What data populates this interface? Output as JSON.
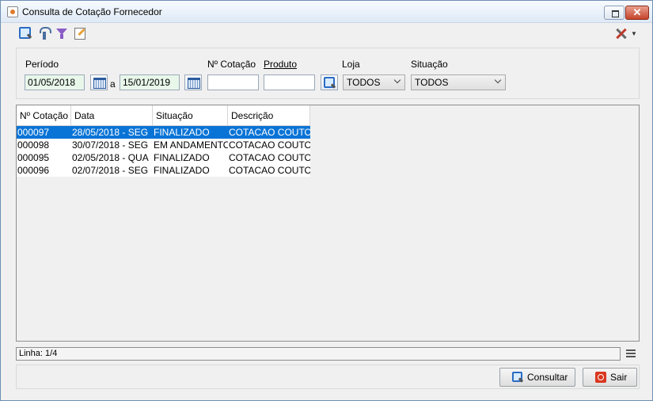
{
  "window": {
    "title": "Consulta de Cotação Fornecedor",
    "close_glyph": "✕"
  },
  "toolbar": {
    "icons": [
      "search-icon",
      "gauge-icon",
      "filter-icon",
      "edit-icon",
      "tools-icon"
    ]
  },
  "filters": {
    "periodo_label": "Período",
    "date_from": "01/05/2018",
    "a_label": "a",
    "date_to": "15/01/2019",
    "cotacao_label": "Nº Cotação",
    "cotacao_value": "",
    "produto_label": "Produto",
    "produto_value": "",
    "loja_label": "Loja",
    "loja_value": "TODOS",
    "situacao_label": "Situação",
    "situacao_value": "TODOS"
  },
  "grid": {
    "columns": [
      "Nº Cotação",
      "Data",
      "Situação",
      "Descrição"
    ],
    "rows": [
      [
        "000097",
        "28/05/2018 - SEG",
        "FINALIZADO",
        "COTACAO COUTO"
      ],
      [
        "000098",
        "30/07/2018 - SEG",
        "EM ANDAMENTO",
        "COTACAO COUTO"
      ],
      [
        "000095",
        "02/05/2018 - QUA",
        "FINALIZADO",
        "COTACAO COUTO"
      ],
      [
        "000096",
        "02/07/2018 - SEG",
        "FINALIZADO",
        "COTACAO COUTO"
      ]
    ],
    "selected_row": 0
  },
  "status": {
    "linha_text": "Linha: 1/4"
  },
  "actions": {
    "consultar_label": "Consultar",
    "sair_label": "Sair"
  },
  "colors": {
    "selection": "#0a74d6",
    "date_field_bg": "#e8f7ea"
  }
}
